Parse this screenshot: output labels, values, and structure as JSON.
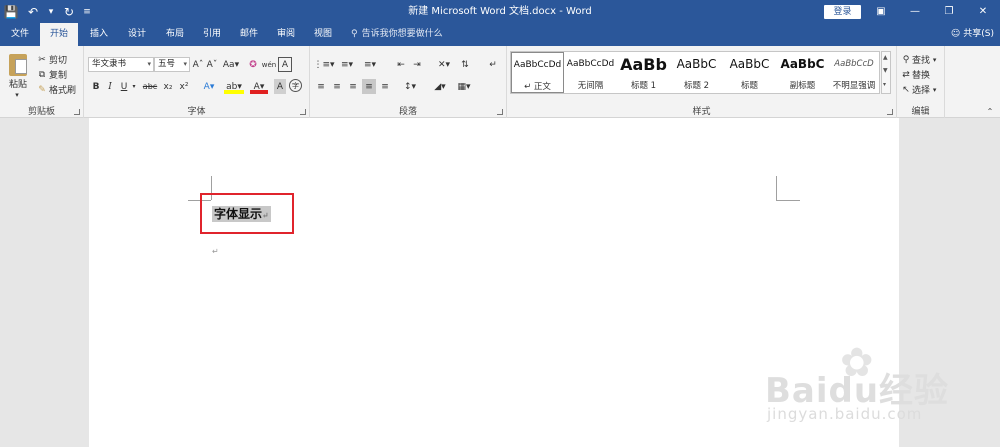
{
  "title_bar": {
    "title": "新建 Microsoft Word 文档.docx - Word",
    "login": "登录",
    "qat": {
      "save_icon": "save-icon",
      "undo_icon": "undo-icon",
      "redo_icon": "redo-icon",
      "customize_icon": "customize-qat-icon"
    }
  },
  "tabs": [
    "文件",
    "开始",
    "插入",
    "设计",
    "布局",
    "引用",
    "邮件",
    "审阅",
    "视图"
  ],
  "active_tab": "开始",
  "tell_me": "告诉我你想要做什么",
  "share": "共享(S)",
  "clipboard": {
    "paste": "粘贴",
    "cut": "剪切",
    "copy": "复制",
    "format_painter": "格式刷",
    "label": "剪贴板"
  },
  "font": {
    "font_name": "华文隶书",
    "font_size": "五号",
    "label": "字体",
    "format_buttons": [
      "B",
      "I",
      "U",
      "abc",
      "x₂",
      "x²"
    ]
  },
  "paragraph": {
    "label": "段落"
  },
  "styles": {
    "label": "样式",
    "items": [
      {
        "preview": "AaBbCcDd",
        "name": "↵ 正文"
      },
      {
        "preview": "AaBbCcDd",
        "name": "无间隔"
      },
      {
        "preview": "AaBb",
        "name": "标题 1"
      },
      {
        "preview": "AaBbC",
        "name": "标题 2"
      },
      {
        "preview": "AaBbC",
        "name": "标题"
      },
      {
        "preview": "AaBbC",
        "name": "副标题"
      },
      {
        "preview": "AaBbCcD",
        "name": "不明显强调"
      }
    ]
  },
  "editing": {
    "find": "查找",
    "replace": "替换",
    "select": "选择",
    "label": "编辑"
  },
  "document": {
    "selected_text": "字体显示",
    "paragraph_mark": "↵"
  },
  "watermark": {
    "brand": "Baidu经验",
    "url": "jingyan.baidu.com"
  },
  "colors": {
    "title_bar": "#2b579a",
    "ribbon": "#f3f3f3",
    "highlight_box": "#e0242c",
    "selection": "#c8c8c8"
  }
}
